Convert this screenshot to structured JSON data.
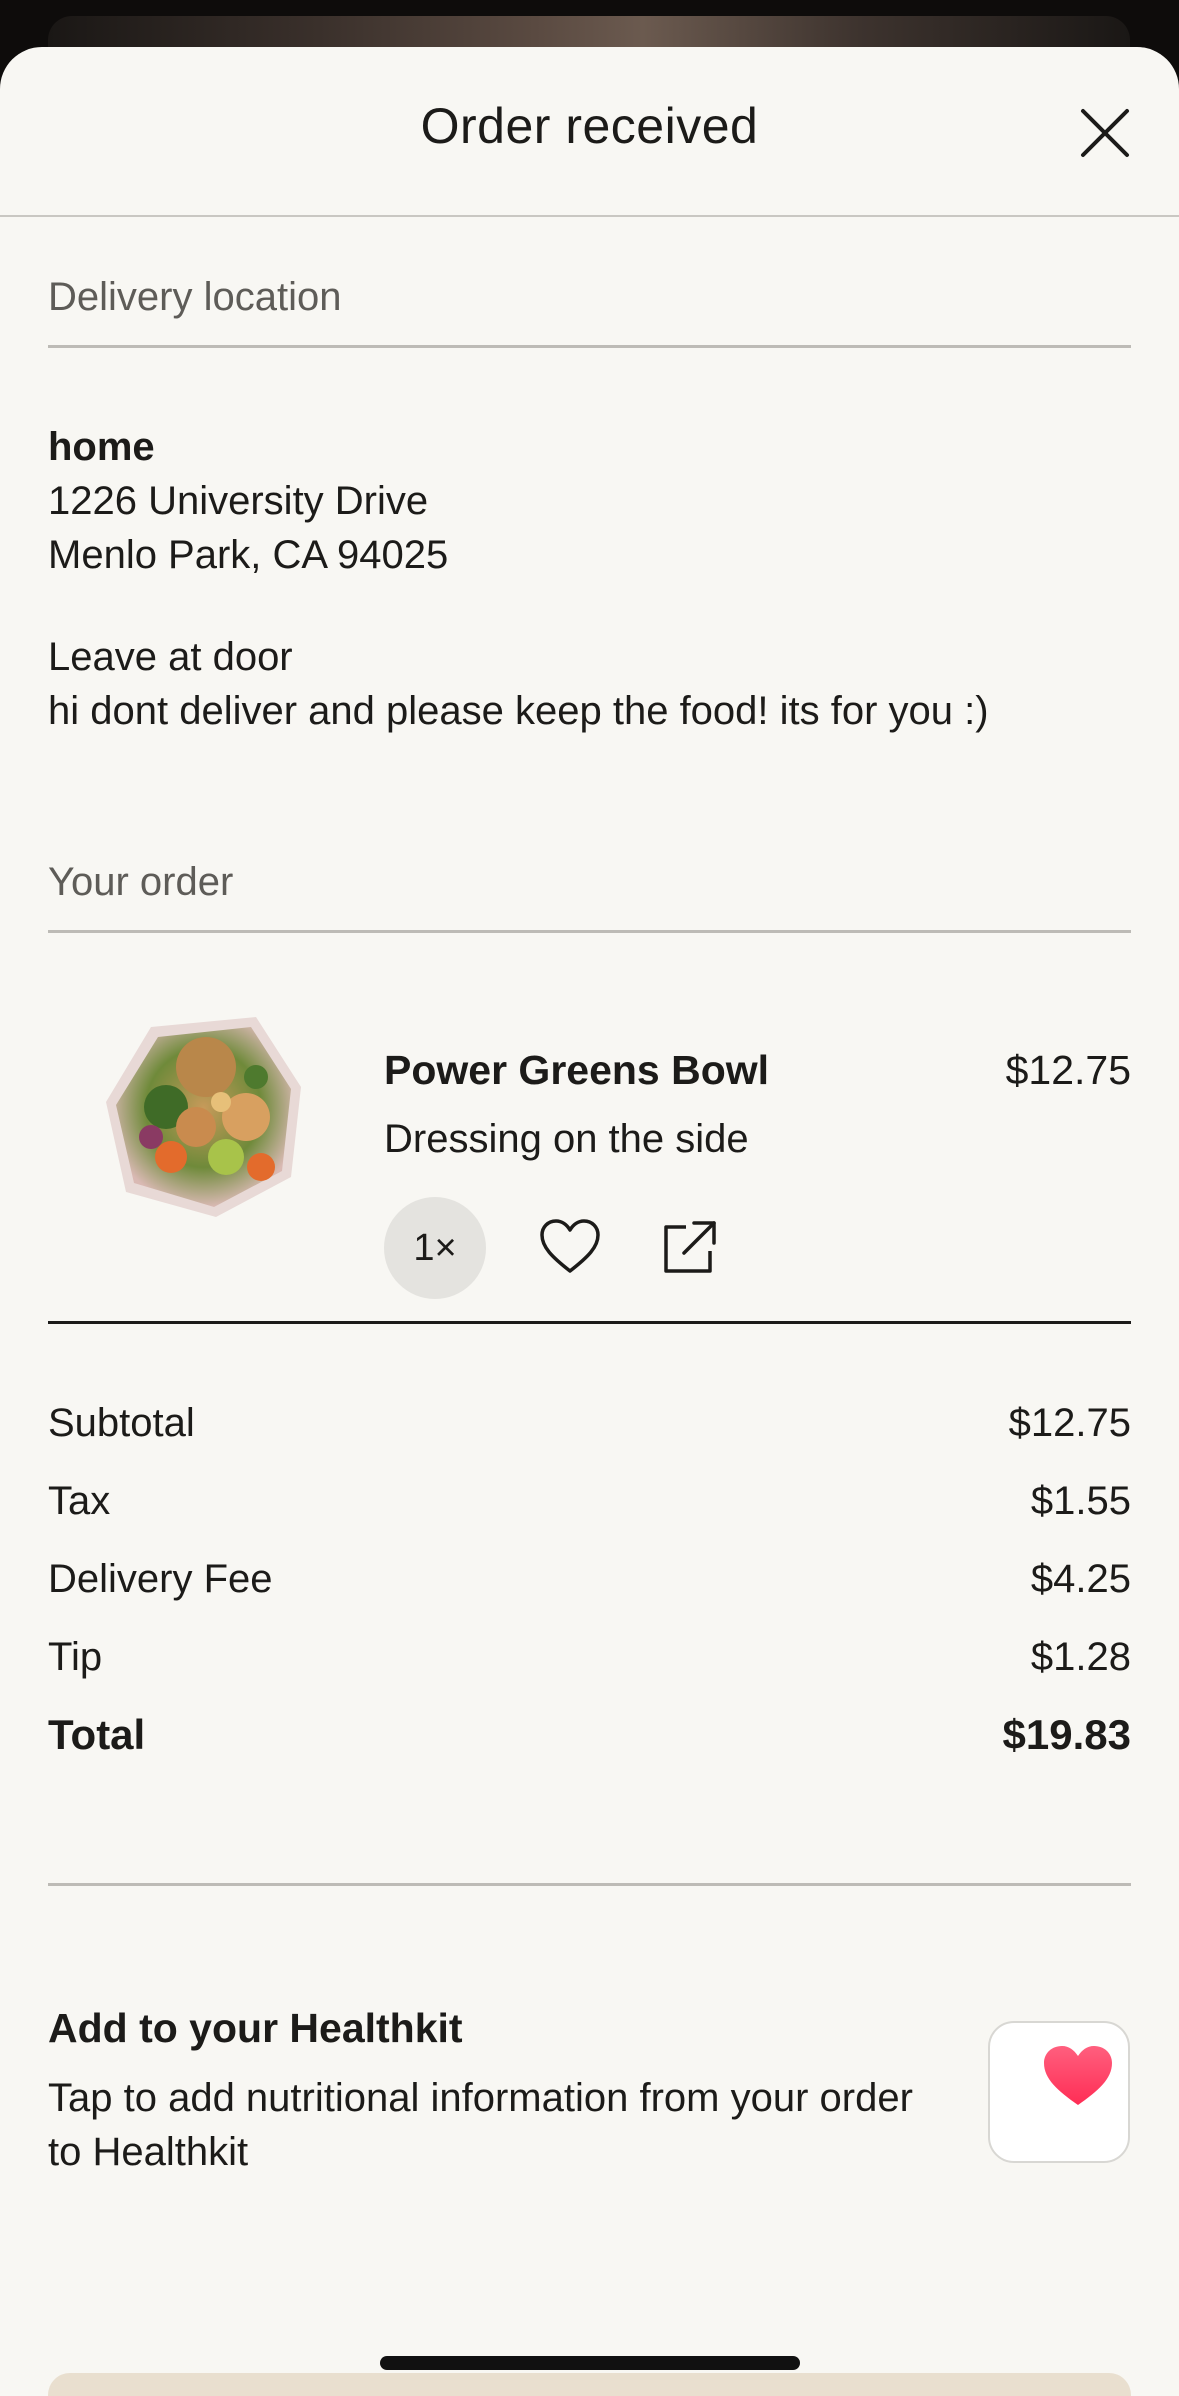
{
  "header": {
    "title": "Order received",
    "close_icon": "close-icon"
  },
  "delivery": {
    "section_label": "Delivery location",
    "location_name": "home",
    "address_line1": "1226 University Drive",
    "address_line2": "Menlo Park, CA 94025",
    "instruction": "Leave at door",
    "note": "hi dont deliver and please keep the food! its for you :)"
  },
  "order": {
    "section_label": "Your order",
    "items": [
      {
        "name": "Power Greens Bowl",
        "price": "$12.75",
        "option": "Dressing on the side",
        "quantity": "1×",
        "icons": [
          "heart-outline-icon",
          "share-icon"
        ]
      }
    ]
  },
  "summary": {
    "rows": [
      {
        "label": "Subtotal",
        "value": "$12.75"
      },
      {
        "label": "Tax",
        "value": "$1.55"
      },
      {
        "label": "Delivery Fee",
        "value": "$4.25"
      },
      {
        "label": "Tip",
        "value": "$1.28"
      }
    ],
    "total": {
      "label": "Total",
      "value": "$19.83"
    }
  },
  "healthkit": {
    "title": "Add to your Healthkit",
    "description": "Tap to add nutritional information from your order to Healthkit",
    "icon": "health-heart-icon"
  },
  "colors": {
    "sheet_background": "#f8f7f3",
    "heart_red": "#ff2d55",
    "bottom_button": "#e9dfcf"
  }
}
